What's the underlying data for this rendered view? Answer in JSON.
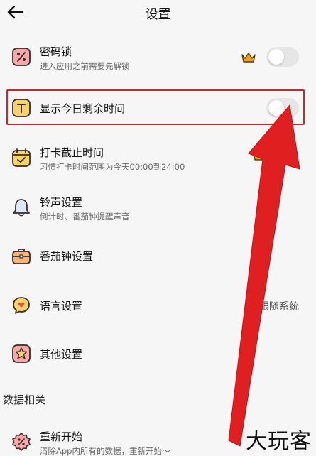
{
  "header": {
    "title": "设置"
  },
  "settings": {
    "password_lock": {
      "title": "密码锁",
      "subtitle": "进入应用之前需要先解锁"
    },
    "show_remaining": {
      "title": "显示今日剩余时间"
    },
    "checkin_deadline": {
      "title": "打卡截止时间",
      "subtitle": "习惯打卡时间范围为今天00:00到24:00",
      "value": "00:00"
    },
    "ringtone": {
      "title": "铃声设置",
      "subtitle": "倒计时、番茄钟提醒声音"
    },
    "pomodoro": {
      "title": "番茄钟设置"
    },
    "language": {
      "title": "语言设置",
      "value": "跟随系统"
    },
    "other": {
      "title": "其他设置"
    }
  },
  "data_section": {
    "header": "数据相关",
    "restart": {
      "title": "重新开始",
      "subtitle": "清除App内所有的数据，重新开始～"
    }
  },
  "watermark": "大玩客",
  "colors": {
    "accent_red": "#e02020",
    "highlight_border": "#c8272d",
    "icon_pink": "#f7a8a8",
    "icon_yellow": "#f7d46a",
    "crown": "#f0a020"
  }
}
